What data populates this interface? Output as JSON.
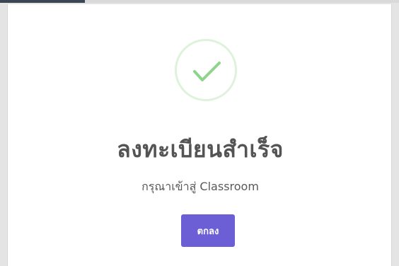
{
  "dialog": {
    "icon": "check-icon",
    "title": "ลงทะเบียนสำเร็จ",
    "message": "กรุณาเข้าสู่ Classroom",
    "ok_label": "ตกลง"
  },
  "colors": {
    "accent": "#6c5fd6",
    "success": "#8ed48a",
    "success_ring": "#dff2dc",
    "title_text": "#545454"
  }
}
